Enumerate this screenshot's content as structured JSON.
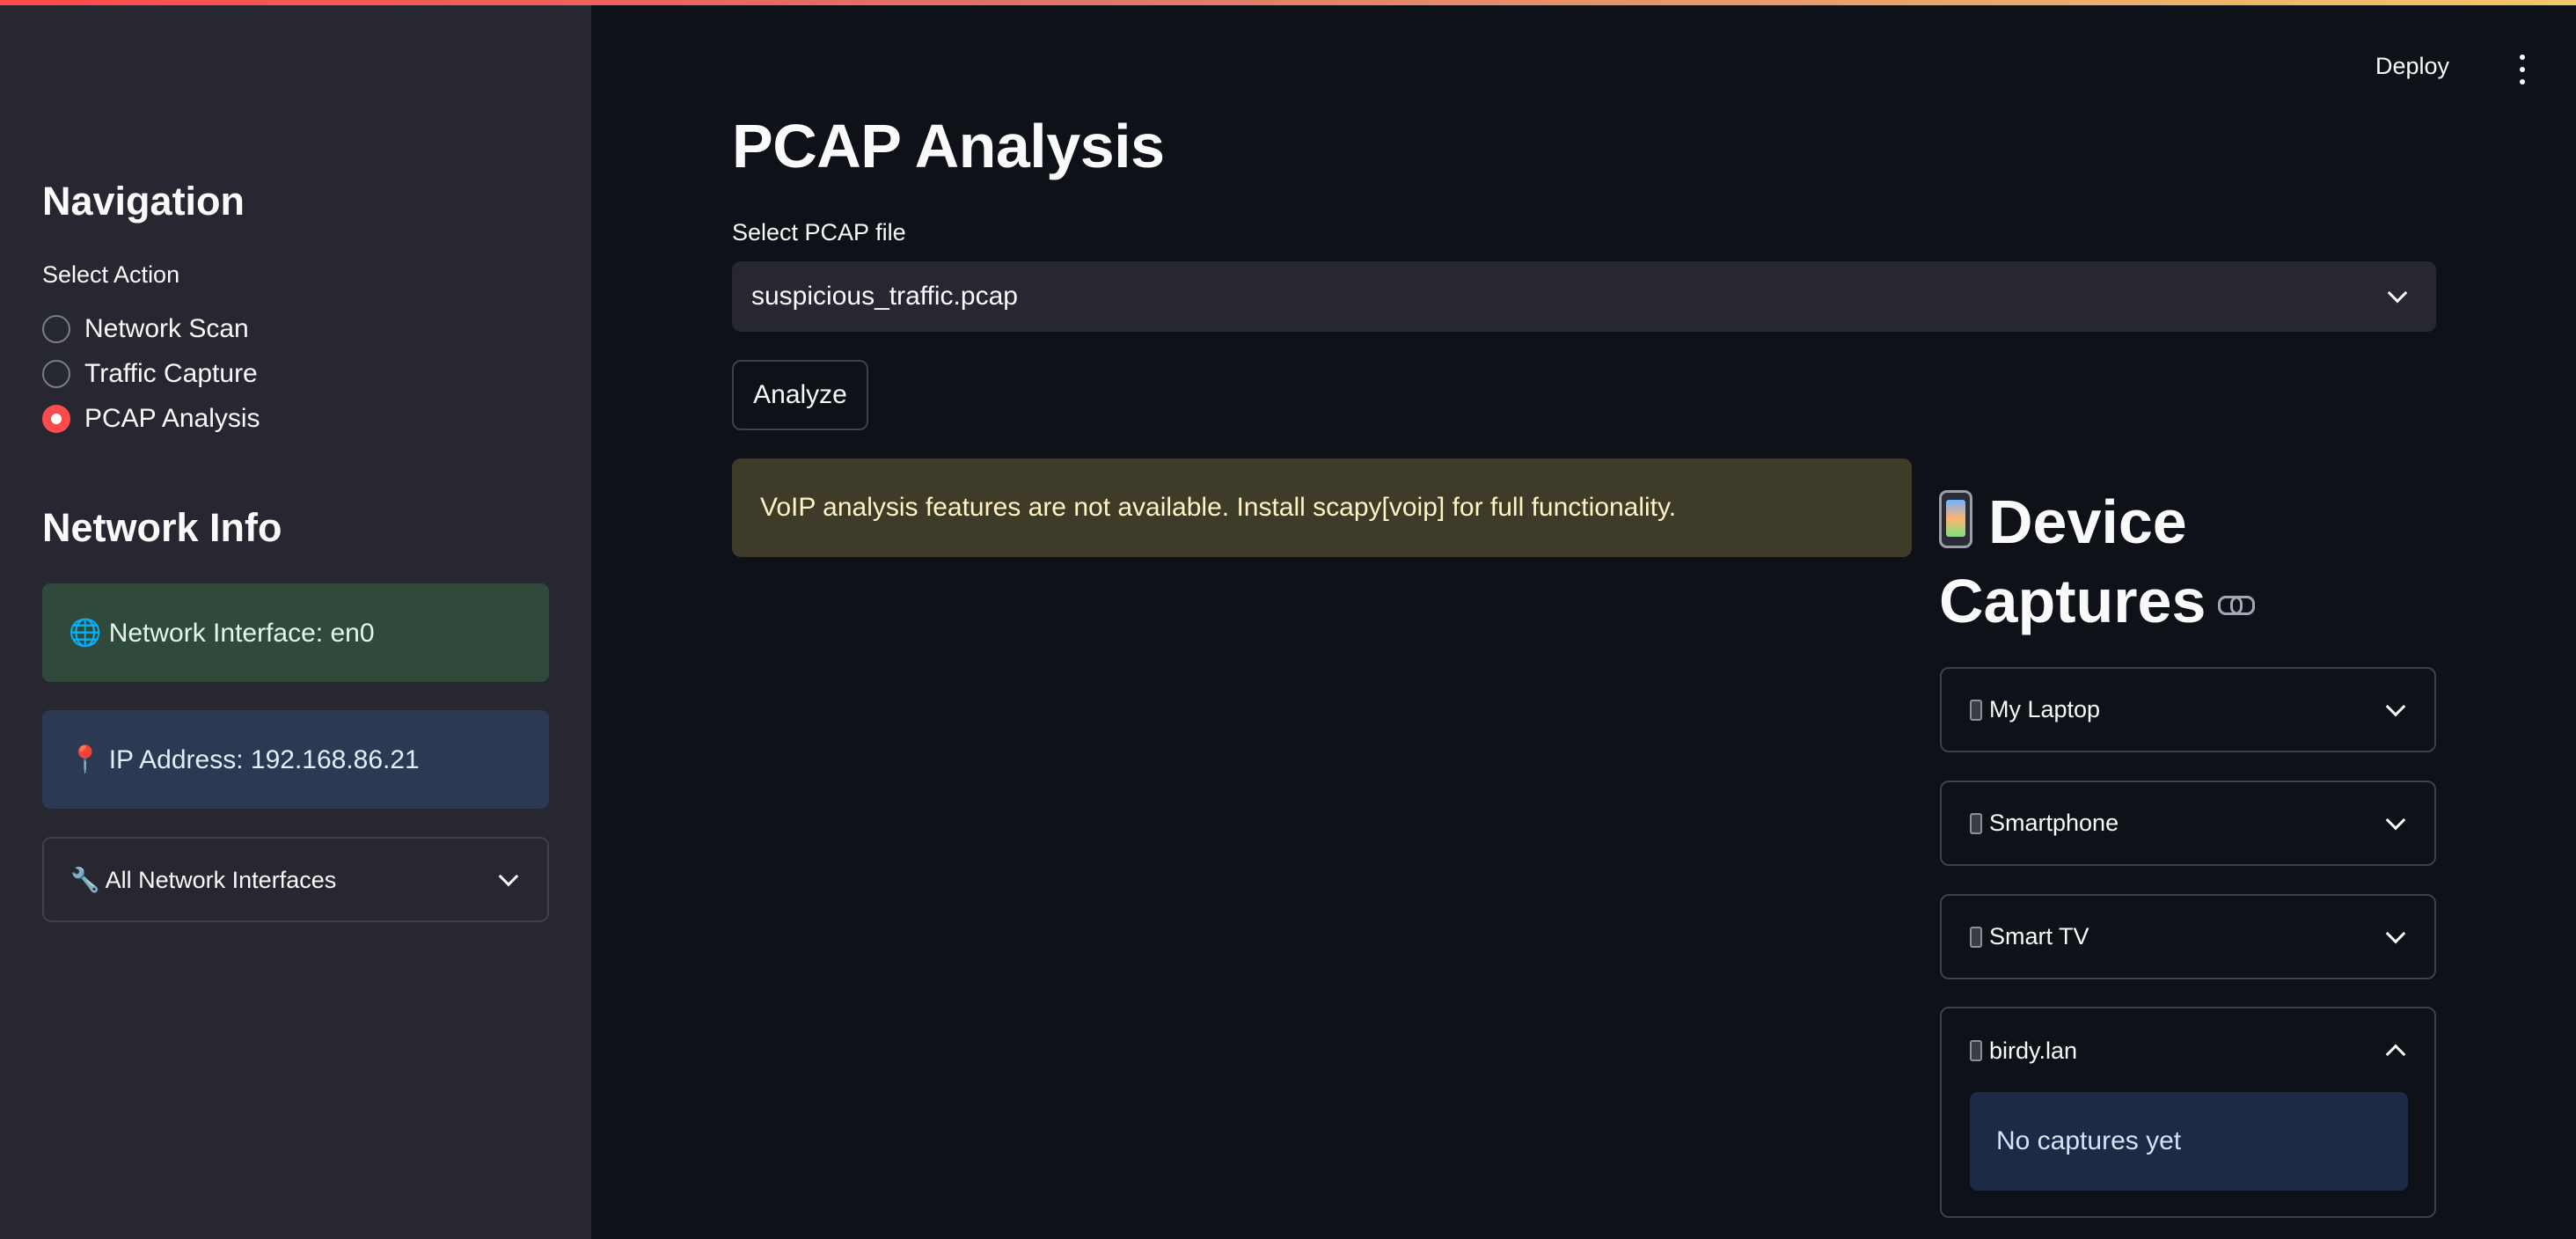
{
  "sidebar": {
    "nav_heading": "Navigation",
    "select_label": "Select Action",
    "actions": [
      {
        "label": "Network Scan",
        "selected": false
      },
      {
        "label": "Traffic Capture",
        "selected": false
      },
      {
        "label": "PCAP Analysis",
        "selected": true
      }
    ],
    "info_heading": "Network Info",
    "interface_text": "🌐 Network Interface: en0",
    "ip_text": "📍 IP Address: 192.168.86.21",
    "all_interfaces_label": "🔧 All Network Interfaces"
  },
  "header": {
    "deploy_label": "Deploy"
  },
  "main": {
    "title": "PCAP Analysis",
    "select_label": "Select PCAP file",
    "selected_file": "suspicious_traffic.pcap",
    "analyze_label": "Analyze",
    "warning_text": "VoIP analysis features are not available. Install scapy[voip] for full functionality."
  },
  "devices": {
    "heading_line1": "Device",
    "heading_line2": "Captures",
    "items": [
      {
        "label": "My Laptop",
        "expanded": false
      },
      {
        "label": "Smartphone",
        "expanded": false
      },
      {
        "label": "Smart TV",
        "expanded": false
      },
      {
        "label": "birdy.lan",
        "expanded": true
      }
    ],
    "empty_text": "No captures yet"
  },
  "colors": {
    "accent": "#ff4b4b",
    "background": "#0e1117",
    "sidebar": "#262730",
    "success_bg": "#2f4a3a",
    "info_bg": "#2b3a52",
    "warning_bg": "#3e3b29"
  }
}
